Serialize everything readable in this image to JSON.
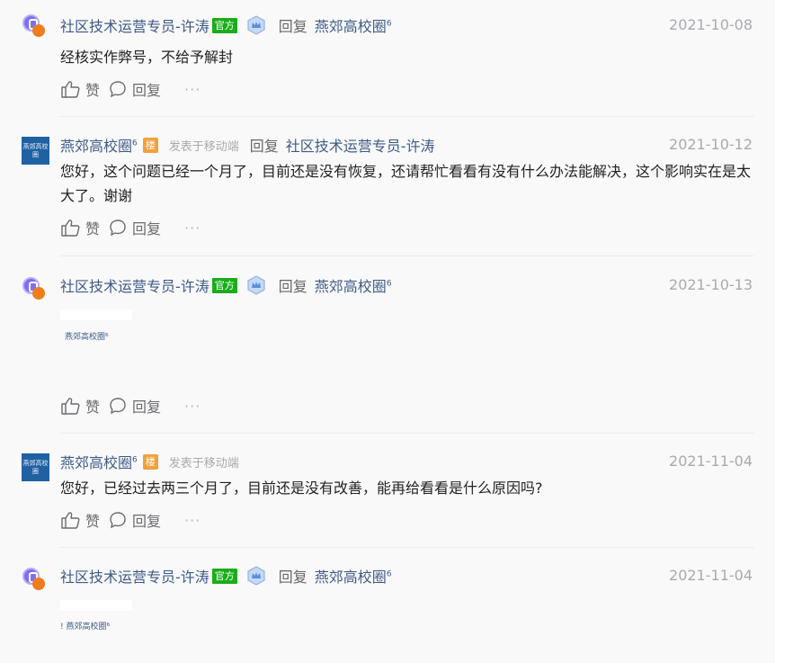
{
  "comments": [
    {
      "author": "社区技术运营专员-许涛",
      "official_badge": "官方",
      "reply_word": "回复",
      "reply_target": "燕郊高校圈",
      "reply_target_level": "6",
      "date": "2021-10-08",
      "content": "经核实作弊号，不给予解封",
      "actions": {
        "like": "赞",
        "reply": "回复",
        "more": "···"
      }
    },
    {
      "author": "燕郊高校圈",
      "author_level": "6",
      "floor_badge": "楼",
      "source": "发表于移动端",
      "reply_word": "回复",
      "reply_target": "社区技术运营专员-许涛",
      "date": "2021-10-12",
      "content": "您好，这个问题已经一个月了，目前还是没有恢复，还请帮忙看看有没有什么办法能解决，这个影响实在是太大了。谢谢",
      "actions": {
        "like": "赞",
        "reply": "回复",
        "more": "···"
      }
    },
    {
      "author": "社区技术运营专员-许涛",
      "official_badge": "官方",
      "reply_word": "回复",
      "reply_target": "燕郊高校圈",
      "reply_target_level": "6",
      "date": "2021-10-13",
      "embed_text": "燕郊高校圈⁶",
      "actions": {
        "like": "赞",
        "reply": "回复",
        "more": "···"
      }
    },
    {
      "author": "燕郊高校圈",
      "author_level": "6",
      "floor_badge": "楼",
      "source": "发表于移动端",
      "date": "2021-11-04",
      "content": "您好，已经过去两三个月了，目前还是没有改善，能再给看看是什么原因吗?",
      "actions": {
        "like": "赞",
        "reply": "回复",
        "more": "···"
      }
    },
    {
      "author": "社区技术运营专员-许涛",
      "official_badge": "官方",
      "reply_word": "回复",
      "reply_target": "燕郊高校圈",
      "reply_target_level": "6",
      "date": "2021-11-04",
      "embed_text": "! 燕郊高校圈⁶"
    }
  ],
  "avatar_user_text": "燕郊高校圈",
  "colors": {
    "link": "#3d5a86",
    "official_badge": "#1aad19",
    "floor_badge": "#f1a13c",
    "muted": "#a9a9b0",
    "background": "#f9f9fa"
  },
  "icons": [
    "thumbs-up-icon",
    "comment-bubble-icon",
    "crown-shield-icon",
    "more-dots-icon"
  ]
}
